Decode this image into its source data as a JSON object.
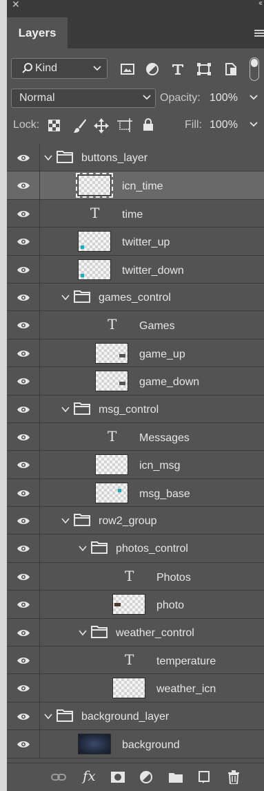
{
  "window": {
    "close_glyph": "✕",
    "collapse_glyph": "‹‹"
  },
  "panel": {
    "tab_label": "Layers"
  },
  "filter": {
    "kind_label": "Kind",
    "icons": [
      "image-filter-icon",
      "adjustment-filter-icon",
      "type-filter-icon",
      "shape-filter-icon",
      "smart-object-filter-icon",
      "filter-toggle"
    ]
  },
  "blend": {
    "mode": "Normal",
    "opacity_label": "Opacity:",
    "opacity_value": "100%"
  },
  "lock": {
    "label": "Lock:",
    "fill_label": "Fill:",
    "fill_value": "100%",
    "icons": [
      "lock-transparent-pixels-icon",
      "lock-image-pixels-icon",
      "lock-position-icon",
      "lock-artboard-icon",
      "lock-all-icon"
    ]
  },
  "layers": [
    {
      "name": "buttons_layer",
      "kind": "group",
      "expanded": true
    },
    {
      "name": "icn_time",
      "kind": "pixel",
      "selected": true
    },
    {
      "name": "time",
      "kind": "text"
    },
    {
      "name": "twitter_up",
      "kind": "pixel"
    },
    {
      "name": "twitter_down",
      "kind": "pixel"
    },
    {
      "name": "games_control",
      "kind": "group",
      "expanded": true
    },
    {
      "name": "Games",
      "kind": "text"
    },
    {
      "name": "game_up",
      "kind": "pixel"
    },
    {
      "name": "game_down",
      "kind": "pixel"
    },
    {
      "name": "msg_control",
      "kind": "group",
      "expanded": true
    },
    {
      "name": "Messages",
      "kind": "text"
    },
    {
      "name": "icn_msg",
      "kind": "pixel"
    },
    {
      "name": "msg_base",
      "kind": "pixel"
    },
    {
      "name": "row2_group",
      "kind": "group",
      "expanded": true
    },
    {
      "name": "photos_control",
      "kind": "group",
      "expanded": true
    },
    {
      "name": "Photos",
      "kind": "text"
    },
    {
      "name": "photo",
      "kind": "pixel"
    },
    {
      "name": "weather_control",
      "kind": "group",
      "expanded": true
    },
    {
      "name": "temperature",
      "kind": "text"
    },
    {
      "name": "weather_icn",
      "kind": "pixel"
    },
    {
      "name": "background_layer",
      "kind": "group",
      "expanded": true
    },
    {
      "name": "background",
      "kind": "pixel"
    }
  ],
  "bottom_toolbar": {
    "fx_label": "fx",
    "icons": [
      "link-layers-icon",
      "fx-icon",
      "layer-mask-icon",
      "adjustment-layer-icon",
      "new-group-icon",
      "new-layer-icon",
      "delete-layer-icon"
    ]
  },
  "colors": {
    "panel_bg": "#535353",
    "selected_row": "#696969",
    "accent_cyan": "#17b0c2"
  }
}
